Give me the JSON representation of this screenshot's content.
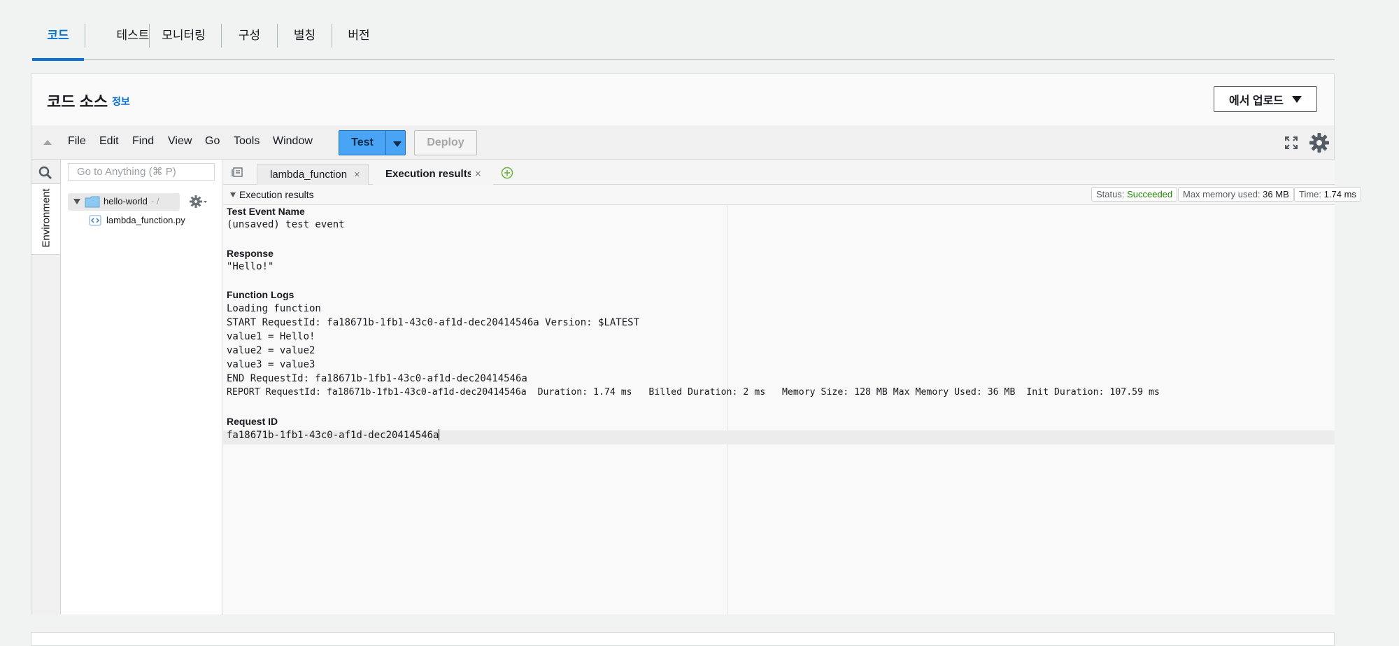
{
  "top_tabs": [
    {
      "label": "코드",
      "active": true
    },
    {
      "label": "테스트",
      "active": false
    },
    {
      "label": "모니터링",
      "active": false
    },
    {
      "label": "구성",
      "active": false
    },
    {
      "label": "별칭",
      "active": false
    },
    {
      "label": "버전",
      "active": false
    }
  ],
  "panel": {
    "title": "코드 소스",
    "info_link": "정보",
    "upload_label": "에서 업로드"
  },
  "menu": {
    "items": [
      "File",
      "Edit",
      "Find",
      "View",
      "Go",
      "Tools",
      "Window"
    ],
    "test_label": "Test",
    "deploy_label": "Deploy"
  },
  "sidebar": {
    "environment_label": "Environment",
    "goto_placeholder": "Go to Anything (⌘ P)",
    "folder_name": "hello-world",
    "folder_path": "- /",
    "file_name": "lambda_function.py"
  },
  "editor_tabs": [
    {
      "label": "lambda_function",
      "active": false
    },
    {
      "label": "Execution results",
      "active": true
    }
  ],
  "results": {
    "title": "Execution results",
    "status_label": "Status:",
    "status_value": "Succeeded",
    "memory_label": "Max memory used:",
    "memory_value": "36 MB",
    "time_label": "Time:",
    "time_value": "1.74 ms",
    "test_event_heading": "Test Event Name",
    "test_event_value": "(unsaved) test event",
    "response_heading": "Response",
    "response_value": "\"Hello!\"",
    "logs_heading": "Function Logs",
    "log_lines": [
      "Loading function",
      "START RequestId: fa18671b-1fb1-43c0-af1d-dec20414546a Version: $LATEST",
      "value1 = Hello!",
      "value2 = value2",
      "value3 = value3",
      "END RequestId: fa18671b-1fb1-43c0-af1d-dec20414546a",
      "REPORT RequestId: fa18671b-1fb1-43c0-af1d-dec20414546a  Duration: 1.74 ms   Billed Duration: 2 ms   Memory Size: 128 MB Max Memory Used: 36 MB  Init Duration: 107.59 ms"
    ],
    "request_id_heading": "Request ID",
    "request_id_value": "fa18671b-1fb1-43c0-af1d-dec20414546a"
  }
}
